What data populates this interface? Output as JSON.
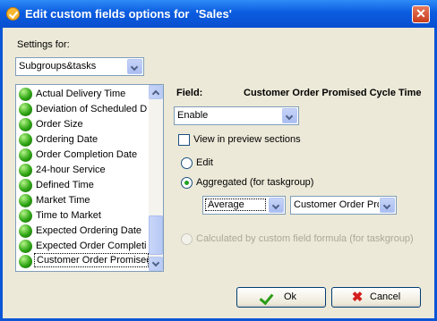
{
  "window": {
    "title": "Edit custom fields options for  'Sales'",
    "close_glyph": "✕"
  },
  "settings": {
    "label": "Settings for:",
    "selected": "Subgroups&tasks"
  },
  "list": {
    "items": [
      "Actual Delivery Time",
      "Deviation of Scheduled D",
      "Order Size",
      "Ordering Date",
      "Order Completion Date",
      "24-hour Service",
      "Defined Time",
      "Market Time",
      "Time to Market",
      "Expected Ordering Date",
      "Expected Order Completio",
      "Customer Order Promised"
    ],
    "selected_index": 11
  },
  "field": {
    "label": "Field:",
    "name": "Customer Order Promised Cycle Time",
    "enable_value": "Enable",
    "preview_label": "View in preview sections",
    "preview_checked": false
  },
  "options": {
    "edit_label": "Edit",
    "aggregated_label": "Aggregated (for taskgroup)",
    "aggregated_checked": true,
    "function_value": "Average",
    "field_value": "Customer Order Pror",
    "formula_label": "Calculated by custom field formula (for taskgroup)"
  },
  "buttons": {
    "ok": "Ok",
    "cancel": "Cancel"
  },
  "icons": {
    "title": "checkmark-badge-icon",
    "item": "green-ball-icon",
    "ok": "checkmark-icon",
    "cancel": "red-x-icon"
  }
}
